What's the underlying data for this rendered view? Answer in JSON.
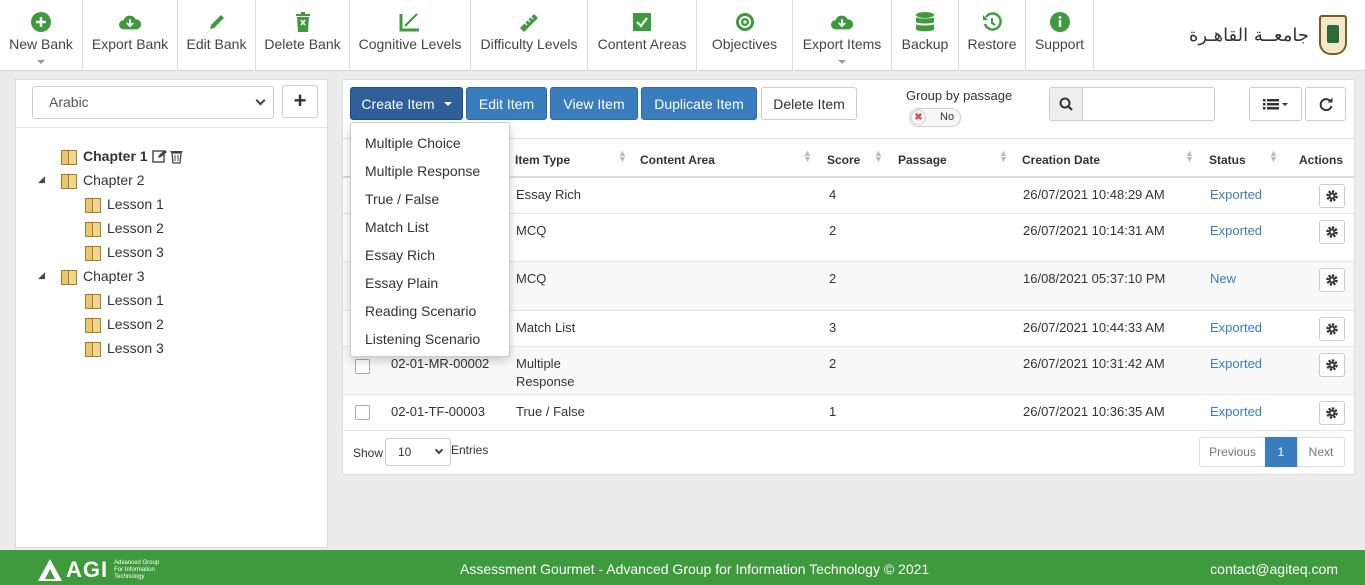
{
  "toolbar": {
    "items": [
      {
        "label": "New Bank",
        "icon": "plus-circle-icon",
        "has_menu": true
      },
      {
        "label": "Export Bank",
        "icon": "cloud-download-icon",
        "has_menu": false
      },
      {
        "label": "Edit Bank",
        "icon": "pencil-icon",
        "has_menu": false
      },
      {
        "label": "Delete Bank",
        "icon": "trash-icon",
        "has_menu": false
      },
      {
        "label": "Cognitive Levels",
        "icon": "measure-icon",
        "has_menu": false
      },
      {
        "label": "Difficulty Levels",
        "icon": "ruler-icon",
        "has_menu": false
      },
      {
        "label": "Content Areas",
        "icon": "checkbox-icon",
        "has_menu": false
      },
      {
        "label": "Objectives",
        "icon": "target-icon",
        "has_menu": false
      },
      {
        "label": "Export Items",
        "icon": "cloud-download-icon",
        "has_menu": true
      },
      {
        "label": "Backup",
        "icon": "database-icon",
        "has_menu": false
      },
      {
        "label": "Restore",
        "icon": "history-icon",
        "has_menu": false
      },
      {
        "label": "Support",
        "icon": "info-icon",
        "has_menu": false
      }
    ],
    "icon_color": "#3e9a3c"
  },
  "brand": {
    "name": "جامعــة القاهـرة"
  },
  "sidebar": {
    "language": "Arabic",
    "add_label": "+",
    "tree": [
      {
        "label": "Chapter 1",
        "bold": true
      },
      {
        "label": "Chapter 2",
        "bold": false
      },
      {
        "label": "Lesson 1"
      },
      {
        "label": "Lesson 2"
      },
      {
        "label": "Lesson 3"
      },
      {
        "label": "Chapter 3",
        "bold": false
      },
      {
        "label": "Lesson 1"
      },
      {
        "label": "Lesson 2"
      },
      {
        "label": "Lesson 3"
      }
    ]
  },
  "actions": {
    "create": "Create Item",
    "edit": "Edit Item",
    "view": "View Item",
    "duplicate": "Duplicate Item",
    "delete": "Delete Item",
    "group_by": "Group by passage",
    "group_toggle": "No",
    "group_toggle_mark": "✖"
  },
  "create_menu": [
    "Multiple Choice",
    "Multiple Response",
    "True / False",
    "Match List",
    "Essay Rich",
    "Essay Plain",
    "Reading Scenario",
    "Listening Scenario"
  ],
  "table": {
    "columns": [
      "Item Type",
      "Content Area",
      "Score",
      "Passage",
      "Creation Date",
      "Status",
      "Actions"
    ],
    "rows": [
      {
        "code": "",
        "type": "Essay Rich",
        "type2": "",
        "score": "4",
        "date": "26/07/2021 10:48:29 AM",
        "status": "Exported"
      },
      {
        "code": "",
        "type": "MCQ",
        "type2": "",
        "score": "2",
        "date": "26/07/2021 10:14:31 AM",
        "status": "Exported"
      },
      {
        "code": "",
        "type": "MCQ",
        "type2": "",
        "score": "2",
        "date": "16/08/2021 05:37:10 PM",
        "status": "New"
      },
      {
        "code": "",
        "type": "Match List",
        "type2": "",
        "score": "3",
        "date": "26/07/2021 10:44:33 AM",
        "status": "Exported"
      },
      {
        "code": "02-01-MR-00002",
        "type": "Multiple",
        "type2": "Response",
        "score": "2",
        "date": "26/07/2021 10:31:42 AM",
        "status": "Exported"
      },
      {
        "code": "02-01-TF-00003",
        "type": "True / False",
        "type2": "",
        "score": "1",
        "date": "26/07/2021 10:36:35 AM",
        "status": "Exported"
      }
    ],
    "status_color": "#3a7dbf"
  },
  "pagination": {
    "show_label": "Show",
    "entries_value": "10",
    "entries_label": "Entries",
    "previous": "Previous",
    "current": "1",
    "next": "Next"
  },
  "footer": {
    "logo_text": "AGI",
    "logo_sub": "Advanced Group For Information Technology",
    "copyright": "Assessment Gourmet - Advanced Group for Information Technology © 2021",
    "contact": "contact@agiteq.com",
    "color": "#3e9a3c"
  }
}
